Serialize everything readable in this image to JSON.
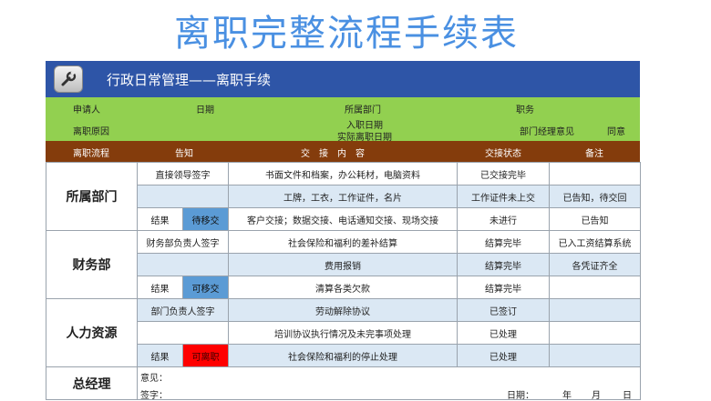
{
  "title": "离职完整流程手续表",
  "header": {
    "text": "行政日常管理——离职手续",
    "icon": "wrench-icon"
  },
  "info": {
    "applicant": "申请人",
    "date": "日期",
    "department": "所属部门",
    "position": "职务",
    "reason": "离职原因",
    "entry_date": "入职日期",
    "actual_leave_date": "实际离职日期",
    "manager_opinion": "部门经理意见",
    "agree": "同意"
  },
  "columns": {
    "process": "离职流程",
    "notify": "告知",
    "handover": "交　接　内　容",
    "status": "交接状态",
    "remark": "备注"
  },
  "sections": [
    {
      "name": "所属部门",
      "rows": [
        {
          "sign": "直接领导签字",
          "content": "书面文件和档案，办公耗材，电脑资料",
          "status": "已交接完毕",
          "remark": ""
        },
        {
          "sign": "",
          "content": "工牌，工衣，工作证件，名片",
          "status": "工作证件未上交",
          "remark": "已告知，待交回"
        },
        {
          "result_label": "结果",
          "result": "待移交",
          "content": "客户交接；数据交接、电话通知交接、现场交接",
          "status": "未进行",
          "remark": "已告知"
        }
      ]
    },
    {
      "name": "财务部",
      "rows": [
        {
          "sign": "财务部负责人签字",
          "content": "社会保险和福利的差补结算",
          "status": "结算完毕",
          "remark": "已入工资结算系统"
        },
        {
          "sign": "",
          "content": "费用报销",
          "status": "结算完毕",
          "remark": "各凭证齐全"
        },
        {
          "result_label": "结果",
          "result": "可移交",
          "content": "清算各类欠款",
          "status": "结算完毕",
          "remark": ""
        }
      ]
    },
    {
      "name": "人力资源",
      "rows": [
        {
          "sign": "部门负责人签字",
          "content": "劳动解除协议",
          "status": "已签订",
          "remark": ""
        },
        {
          "sign": "",
          "content": "培训协议执行情况及未完事项处理",
          "status": "已处理",
          "remark": ""
        },
        {
          "result_label": "结果",
          "result": "可离职",
          "content": "社会保险和福利的停止处理",
          "status": "已处理",
          "remark": ""
        }
      ]
    }
  ],
  "gm": {
    "name": "总经理",
    "opinion": "意见：",
    "sign": "签字：",
    "date_label": "日期：",
    "year": "年",
    "month": "月",
    "day": "日"
  },
  "colors": {
    "title": "#4a90e2",
    "header": "#2e55a7",
    "info": "#92d050",
    "column_bar": "#843c0c",
    "pending": "#5b9bd5",
    "can_leave": "#ff0000"
  }
}
